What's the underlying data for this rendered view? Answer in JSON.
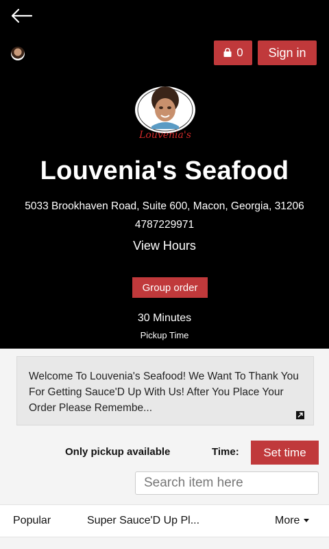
{
  "header": {
    "cart_count": "0",
    "signin_label": "Sign in"
  },
  "restaurant": {
    "logo_text": "Louvenia's",
    "name": "Louvenia's Seafood",
    "address": "5033 Brookhaven Road, Suite 600, Macon, Georgia, 31206",
    "phone": "4787229971",
    "hours_link": "View Hours",
    "group_order_label": "Group order",
    "eta": "30 Minutes",
    "eta_label": "Pickup Time"
  },
  "welcome_message": "Welcome To Louvenia's Seafood! We Want To Thank You For Getting Sauce'D Up With Us! After You Place Your Order Please Remembe...",
  "order_options": {
    "pickup_text": "Only pickup available",
    "time_label": "Time:",
    "set_time_label": "Set time"
  },
  "search": {
    "placeholder": "Search item here"
  },
  "tabs": [
    {
      "label": "Popular"
    },
    {
      "label": "Super Sauce'D Up Pl..."
    },
    {
      "label": "More"
    }
  ],
  "colors": {
    "accent": "#c0393b",
    "hero_bg": "#000000",
    "page_bg": "#f4f4f4"
  },
  "icons": [
    "back-arrow-icon",
    "avatar",
    "shopping-bag-icon",
    "logo",
    "expand-icon",
    "chevron-down-icon"
  ]
}
